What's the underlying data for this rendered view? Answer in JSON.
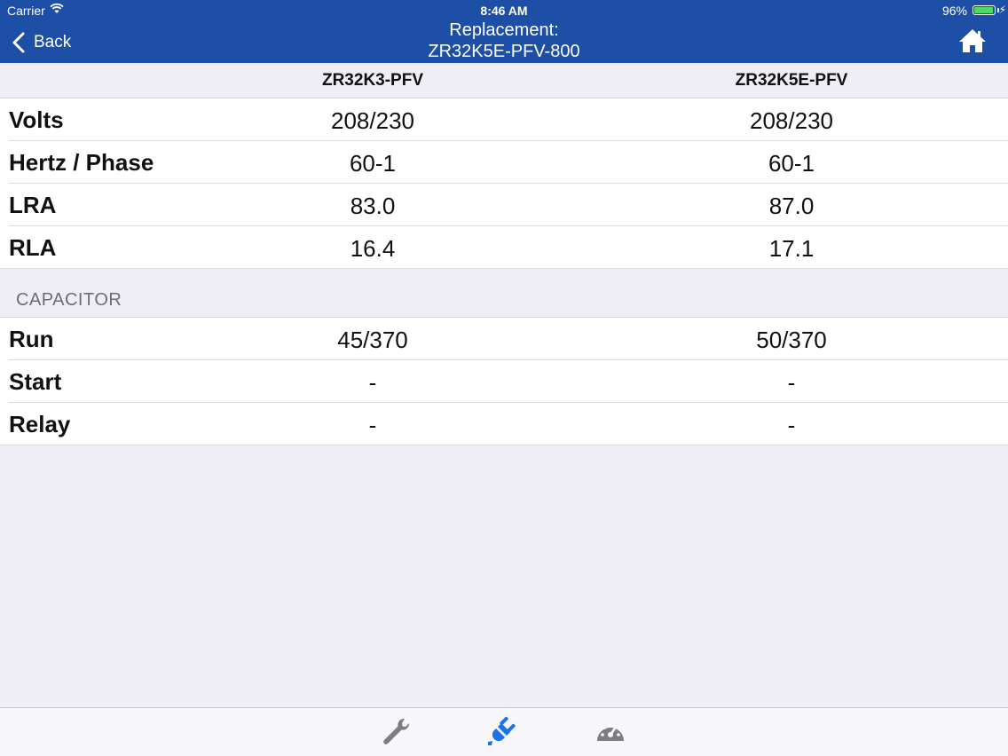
{
  "status_bar": {
    "carrier": "Carrier",
    "time": "8:46 AM",
    "battery": "96%"
  },
  "navbar": {
    "back_label": "Back",
    "title_line1": "Replacement:",
    "title_line2": "ZR32K5E-PFV-800"
  },
  "columns": {
    "col1": "ZR32K3-PFV",
    "col2": "ZR32K5E-PFV"
  },
  "electrical_rows": [
    {
      "label": "Volts",
      "v1": "208/230",
      "v2": "208/230"
    },
    {
      "label": "Hertz / Phase",
      "v1": "60-1",
      "v2": "60-1"
    },
    {
      "label": "LRA",
      "v1": "83.0",
      "v2": "87.0"
    },
    {
      "label": "RLA",
      "v1": "16.4",
      "v2": "17.1"
    }
  ],
  "capacitor_section": {
    "title": "CAPACITOR",
    "rows": [
      {
        "label": "Run",
        "v1": "45/370",
        "v2": "50/370"
      },
      {
        "label": "Start",
        "v1": "-",
        "v2": "-"
      },
      {
        "label": "Relay",
        "v1": "-",
        "v2": "-"
      }
    ]
  },
  "tabs": [
    {
      "icon": "wrench-icon",
      "active": false
    },
    {
      "icon": "plug-icon",
      "active": true
    },
    {
      "icon": "gauge-icon",
      "active": false
    }
  ],
  "colors": {
    "nav_bg": "#1e4fa6",
    "active_tab": "#1a73e8",
    "inactive_tab": "#7d7d82"
  }
}
